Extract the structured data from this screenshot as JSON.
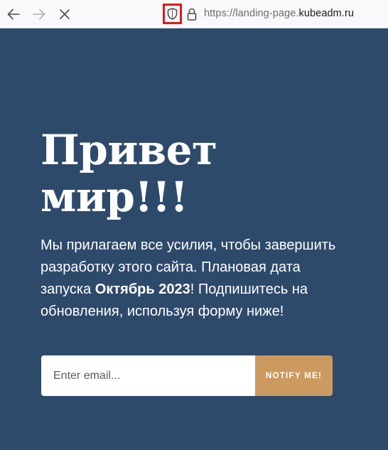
{
  "browser": {
    "url_prefix": "https://landing-page.",
    "url_host": "kubeadm.ru",
    "icons": [
      "back-arrow-icon",
      "forward-arrow-icon",
      "stop-icon",
      "shield-icon",
      "lock-icon"
    ],
    "highlight_color": "#e0191b"
  },
  "hero": {
    "title": "Привет мир!!!",
    "desc_before": "Мы прилагаем все усилия, чтобы завершить разработку этого сайта. Плановая дата запуска ",
    "desc_date": "Октябрь 2023",
    "desc_after": "! Подпишитесь на обновления, используя форму ниже!",
    "background_color": "#2e4a6b"
  },
  "form": {
    "email_placeholder": "Enter email...",
    "email_value": "",
    "button_label": "NOTIFY ME!",
    "button_color": "#cc9a5f"
  }
}
